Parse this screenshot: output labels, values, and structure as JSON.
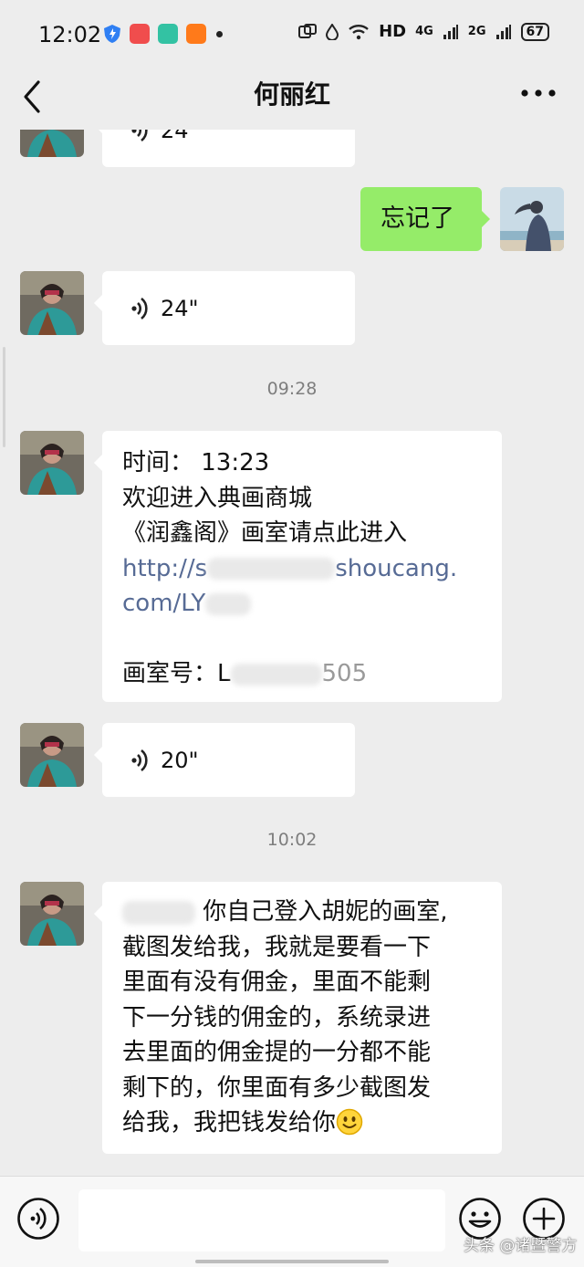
{
  "status_bar": {
    "time": "12:02",
    "network_label": "HD",
    "signal_4g": "4G",
    "signal_2g": "2G",
    "battery": "67",
    "app_icons": [
      "shield-app-icon",
      "orange-app-icon",
      "green-app-icon",
      "taobao-app-icon"
    ]
  },
  "nav": {
    "title": "何丽红"
  },
  "messages": {
    "voice_top_partial": "24",
    "sent_text": "忘记了",
    "voice_1": "24\"",
    "time_1": "09:28",
    "text_msg": {
      "line1": "时间： 13:23",
      "line2": "欢迎进入典画商城",
      "line3": "《润鑫阁》画室请点此进入",
      "link_a": "http://s",
      "link_b": "shoucang.",
      "link_c": "com/LY",
      "room_prefix": "画室号：L",
      "room_suffix": "505"
    },
    "voice_2": "20\"",
    "time_2": "10:02",
    "long_msg": {
      "first_line": "你自己登入胡妮的画室,",
      "body": "截图发给我，我就是要看一下\n里面有没有佣金，里面不能剩\n下一分钱的佣金的，系统录进\n去里面的佣金提的一分都不能\n剩下的，你里面有多少截图发\n给我，我把钱发给你"
    }
  },
  "watermark": "头条 @诸暨警方",
  "colors": {
    "background": "#ededed",
    "sent_bubble": "#95ec69",
    "received_bubble": "#ffffff",
    "link": "#576b95",
    "timestamp": "#7e7e7e"
  }
}
